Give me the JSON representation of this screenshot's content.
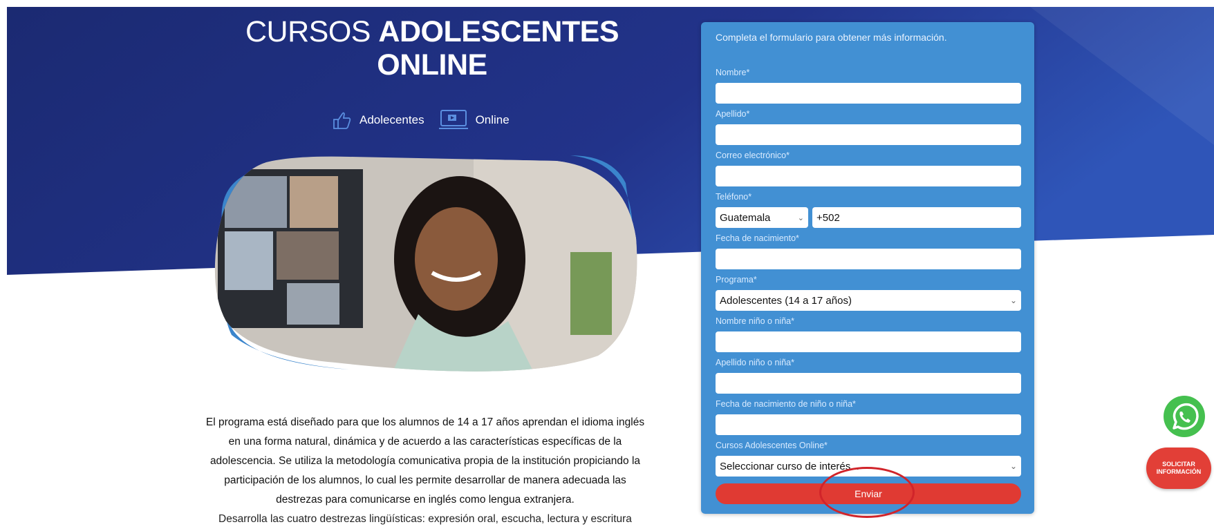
{
  "hero": {
    "title_regular": "CURSOS ",
    "title_bold_1": "ADOLESCENTES",
    "title_bold_2": "ONLINE",
    "tags": [
      "Adolecentes",
      "Online"
    ],
    "colors": {
      "navy": "#1f2e78",
      "accent_blue": "#3b85cc"
    }
  },
  "description": {
    "paragraph": "El programa está diseñado para que los alumnos de 14 a 17 años aprendan el idioma inglés en una forma natural, dinámica y de acuerdo a las características específicas de la adolescencia. Se utiliza la metodología comunicativa propia de la institución propiciando la participación de los alumnos, lo cual les permite desarrollar de manera adecuada las destrezas para comunicarse en inglés como lengua extranjera.",
    "cut_line": "Desarrolla las cuatro destrezas lingüísticas: expresión oral, escucha, lectura y escritura"
  },
  "form": {
    "intro": "Completa el formulario para obtener más información.",
    "labels": {
      "nombre": "Nombre*",
      "apellido": "Apellido*",
      "correo": "Correo electrónico*",
      "telefono": "Teléfono*",
      "fecha": "Fecha de nacimiento*",
      "programa": "Programa*",
      "nombre_nino": "Nombre niño o niña*",
      "apellido_nino": "Apellido niño o niña*",
      "fecha_nino": "Fecha de nacimiento de niño o niña*",
      "cursos": "Cursos Adolescentes Online*"
    },
    "values": {
      "country": "Guatemala",
      "phone_code": "+502",
      "programa": "Adolescentes (14 a 17 años)",
      "cursos": "Seleccionar curso de interés..."
    },
    "submit": "Enviar",
    "colors": {
      "panel": "#4290d3",
      "submit": "#e03a33"
    }
  },
  "floating": {
    "solicitar": "SOLICITAR INFORMACIÓN",
    "icons": [
      "whatsapp-icon"
    ]
  }
}
